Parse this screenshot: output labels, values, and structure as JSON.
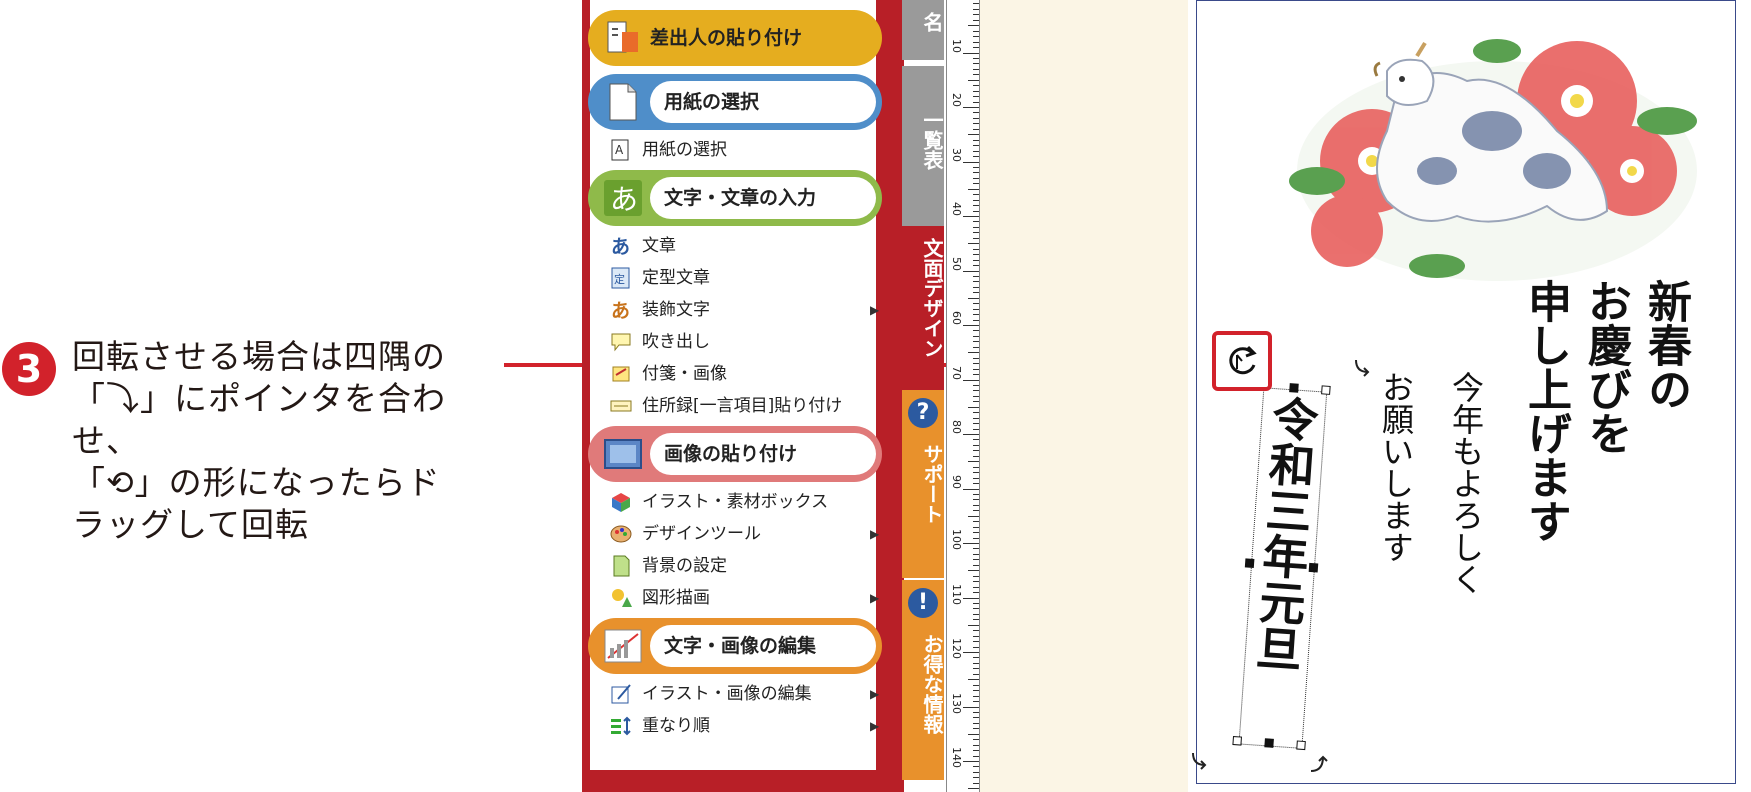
{
  "annotation": {
    "step_number": "3",
    "lines": [
      "回転させる場合は四隅の",
      "「⤵」にポインタを合わせ、",
      "「⟲」の形になったらド",
      "ラッグして回転"
    ]
  },
  "menu": {
    "sections": [
      {
        "label": "差出人の貼り付け",
        "color": "#e5ad1f"
      },
      {
        "label": "用紙の選択",
        "color": "#4f8ec9"
      },
      {
        "label": "文字・文章の入力",
        "color": "#8fba4a"
      },
      {
        "label": "画像の貼り付け",
        "color": "#e07a7a"
      },
      {
        "label": "文字・画像の編集",
        "color": "#e8912c"
      }
    ],
    "paper_items": [
      {
        "label": "用紙の選択"
      }
    ],
    "text_items": [
      {
        "label": "文章",
        "icon": "a-char-icon",
        "submenu": false
      },
      {
        "label": "定型文章",
        "icon": "template-text-icon",
        "submenu": false
      },
      {
        "label": "装飾文字",
        "icon": "decorated-text-icon",
        "submenu": true
      },
      {
        "label": "吹き出し",
        "icon": "speech-bubble-icon",
        "submenu": false
      },
      {
        "label": "付箋・画像",
        "icon": "sticky-note-icon",
        "submenu": false
      },
      {
        "label": "住所録[一言項目]貼り付け",
        "icon": "address-book-icon",
        "submenu": false
      }
    ],
    "image_items": [
      {
        "label": "イラスト・素材ボックス",
        "icon": "cube-icon",
        "submenu": false
      },
      {
        "label": "デザインツール",
        "icon": "palette-icon",
        "submenu": true
      },
      {
        "label": "背景の設定",
        "icon": "background-icon",
        "submenu": false
      },
      {
        "label": "図形描画",
        "icon": "shapes-icon",
        "submenu": true
      }
    ],
    "edit_items": [
      {
        "label": "イラスト・画像の編集",
        "icon": "edit-image-icon",
        "submenu": true
      },
      {
        "label": "重なり順",
        "icon": "layer-order-icon",
        "submenu": true
      }
    ],
    "submenu_arrow": "▶"
  },
  "tabs": [
    {
      "label": "名",
      "color": "#9a9a9a"
    },
    {
      "label": "一覧表",
      "color": "#9a9a9a"
    },
    {
      "label": "文面デザイン",
      "color": "#b81f27"
    },
    {
      "label": "サポート",
      "color": "#e8912c"
    },
    {
      "label": "お得な情報",
      "color": "#e8912c"
    }
  ],
  "tab_icons": [
    "?",
    "!"
  ],
  "ruler": {
    "labels": [
      "10",
      "20",
      "30",
      "40",
      "50",
      "60",
      "70",
      "80",
      "90",
      "100",
      "110",
      "120",
      "130",
      "140"
    ]
  },
  "card": {
    "greeting_lines": [
      "新春の",
      "お慶びを",
      "申し上げます"
    ],
    "message_lines": [
      "今年もよろしく",
      "お願いします"
    ],
    "date_text": "令和三年元旦"
  }
}
